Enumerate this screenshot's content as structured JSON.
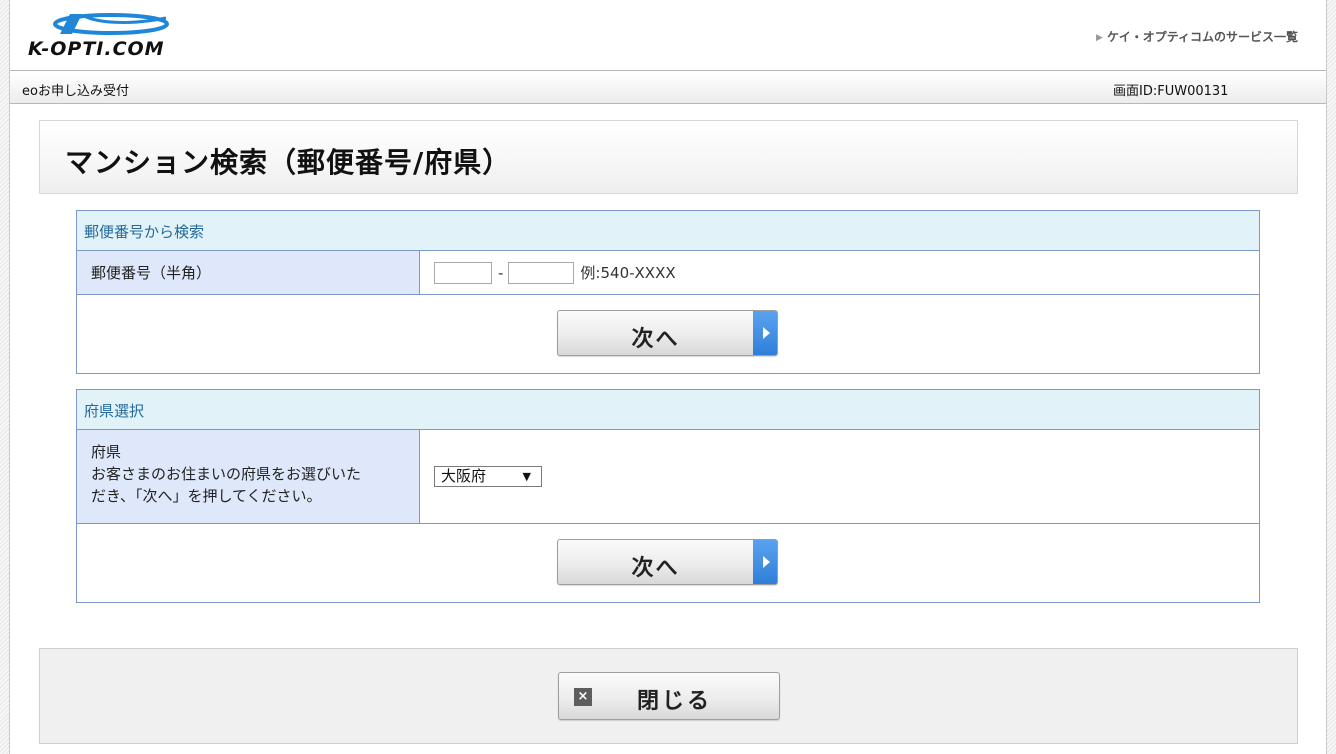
{
  "header": {
    "logo_text": "K-OPTI.COM",
    "service_link": "ケイ・オプティコムのサービス一覧"
  },
  "subbar": {
    "left": "eoお申し込み受付",
    "screen_id": "画面ID:FUW00131"
  },
  "page_title": "マンション検索（郵便番号/府県）",
  "postal_section": {
    "heading": "郵便番号から検索",
    "label": "郵便番号（半角）",
    "zip1_value": "",
    "zip2_value": "",
    "dash": "-",
    "example": "例:540-XXXX",
    "next_label": "次へ"
  },
  "prefecture_section": {
    "heading": "府県選択",
    "label_line1": "府県",
    "label_line2": "お客さまのお住まいの府県をお選びいた",
    "label_line3": "だき、「次へ」を押してください。",
    "selected": "大阪府",
    "next_label": "次へ"
  },
  "footer": {
    "close_label": "閉じる"
  },
  "colors": {
    "section_border": "#7d97c7",
    "section_header_bg": "#e1f3f8",
    "section_header_text": "#24699b",
    "label_bg": "#dfe8fa",
    "button_accent": "#2f7fd9",
    "logo_blue": "#1f86d8"
  }
}
